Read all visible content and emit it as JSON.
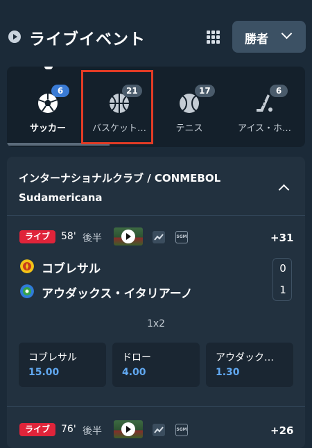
{
  "header": {
    "title": "ライブイベント",
    "sort_value": "勝者"
  },
  "sports": [
    {
      "name": "soccer",
      "label": "サッカー",
      "count": "6"
    },
    {
      "name": "basketball",
      "label": "バスケット…",
      "count": "21"
    },
    {
      "name": "tennis",
      "label": "テニス",
      "count": "17"
    },
    {
      "name": "ice-hockey",
      "label": "アイス・ホ…",
      "count": "6"
    }
  ],
  "competition": {
    "title": "インターナショナルクラブ / CONMEBOL Sudamericana"
  },
  "events": [
    {
      "status": "ライブ",
      "minute": "58'",
      "period": "後半",
      "sgm": "SGM",
      "markets": "+31",
      "teams": [
        {
          "name": "コブレサル",
          "score": "0"
        },
        {
          "name": "アウダックス・イタリアーノ",
          "score": "1"
        }
      ],
      "market_name": "1x2",
      "odds": [
        {
          "label": "コブレサル",
          "price": "15.00"
        },
        {
          "label": "ドロー",
          "price": "4.00"
        },
        {
          "label": "アウダック…",
          "price": "1.30"
        }
      ]
    },
    {
      "status": "ライブ",
      "minute": "76'",
      "period": "後半",
      "sgm": "SGM",
      "markets": "+26"
    }
  ],
  "colors": {
    "background": "#1b2a38",
    "card": "#22313f",
    "live": "#e0243a",
    "odds": "#61a8f0",
    "badge_active": "#3a7bd5"
  }
}
